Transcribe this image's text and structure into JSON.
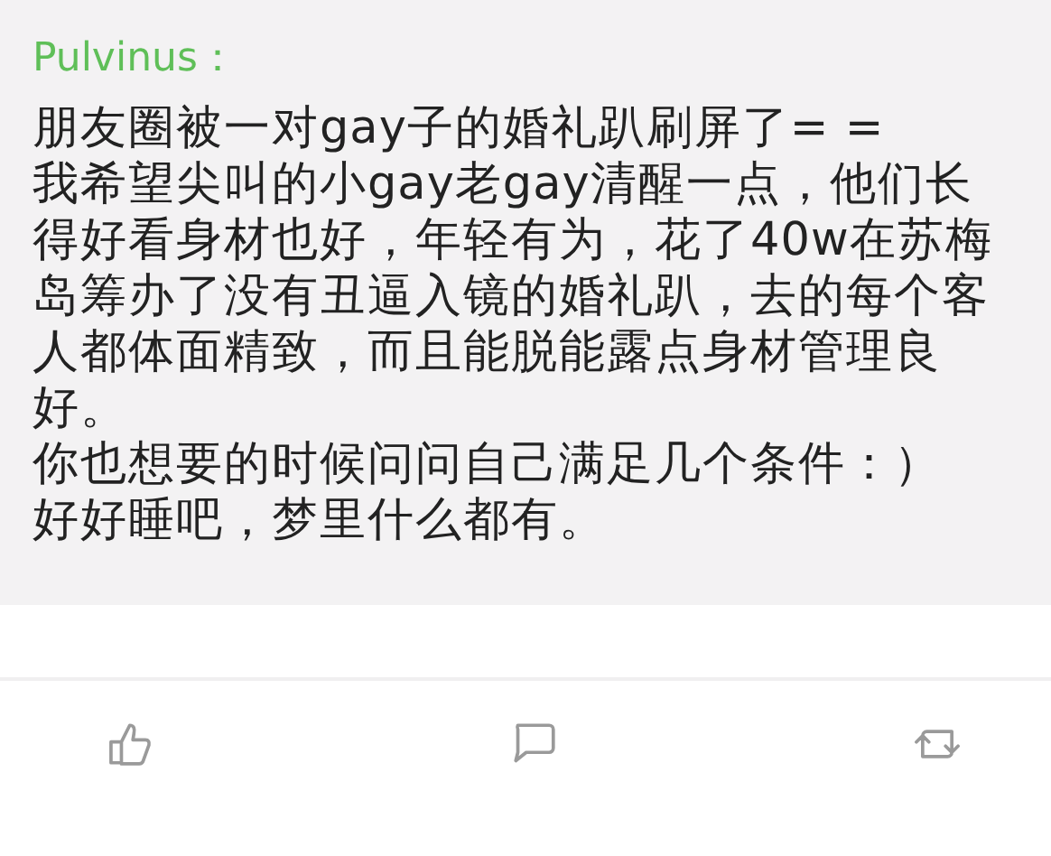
{
  "comment": {
    "author": "Pulvinus：",
    "paragraphs": [
      "朋友圈被一对gay子的婚礼趴刷屏了= =",
      "我希望尖叫的小gay老gay清醒一点，他们长得好看身材也好，年轻有为，花了40w在苏梅岛筹办了没有丑逼入镜的婚礼趴，去的每个客人都体面精致，而且能脱能露点身材管理良好。",
      "你也想要的时候问问自己满足几个条件：）",
      "好好睡吧，梦里什么都有。"
    ]
  },
  "actions": [
    {
      "kind": "like"
    },
    {
      "kind": "comment"
    },
    {
      "kind": "repost"
    }
  ]
}
